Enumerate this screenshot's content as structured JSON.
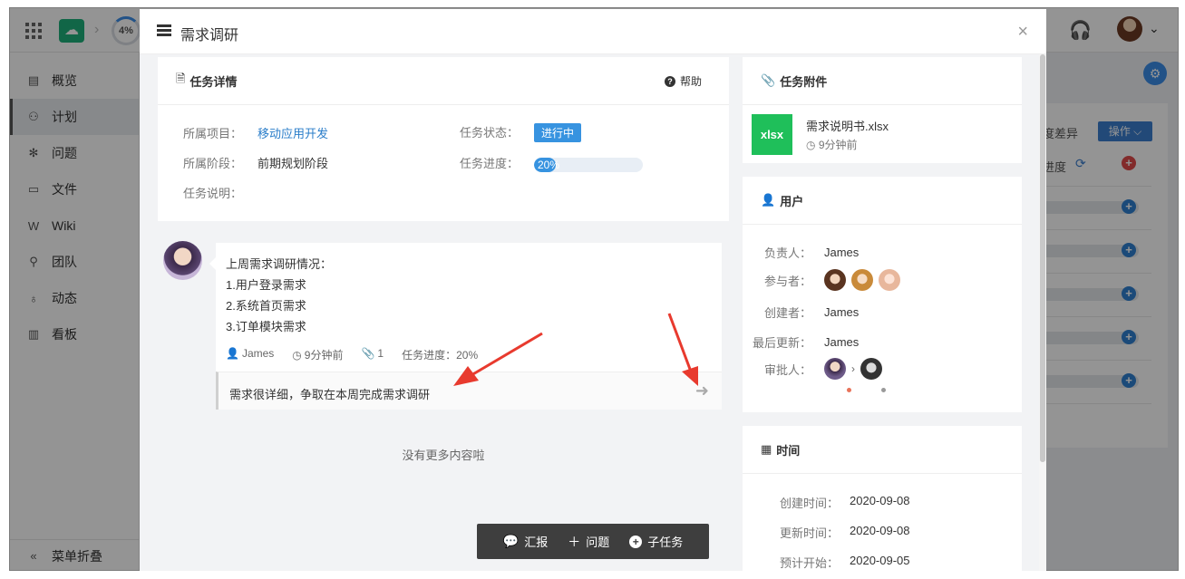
{
  "app": {
    "progress_ring": "4%",
    "sidebar": {
      "items": [
        {
          "label": "概览",
          "icon": "overview-icon",
          "glyph": "▤"
        },
        {
          "label": "计划",
          "icon": "plan-icon",
          "glyph": "⚇"
        },
        {
          "label": "问题",
          "icon": "bug-icon",
          "glyph": "✻"
        },
        {
          "label": "文件",
          "icon": "folder-icon",
          "glyph": "▭"
        },
        {
          "label": "Wiki",
          "icon": "wiki-icon",
          "glyph": "W"
        },
        {
          "label": "团队",
          "icon": "team-icon",
          "glyph": "⚲"
        },
        {
          "label": "动态",
          "icon": "activity-icon",
          "glyph": "♁"
        },
        {
          "label": "看板",
          "icon": "board-icon",
          "glyph": "▥"
        }
      ],
      "active_index": 1,
      "collapse_label": "菜单折叠"
    },
    "background": {
      "progress_diff_label": "度差异",
      "operate_button": "操作 ⌵",
      "progress_label": "进度"
    }
  },
  "modal": {
    "title": "需求调研",
    "close_glyph": "×",
    "task_detail": {
      "heading": "任务详情",
      "help_label": "帮助",
      "project_label": "所属项目：",
      "project_value": "移动应用开发",
      "stage_label": "所属阶段：",
      "stage_value": "前期规划阶段",
      "desc_label": "任务说明：",
      "status_label": "任务状态：",
      "status_value": "进行中",
      "progress_label": "任务进度：",
      "progress_text": "20%",
      "progress_fraction": 0.2
    },
    "comment": {
      "lines": [
        "上周需求调研情况：",
        "1.用户登录需求",
        "2.系统首页需求",
        "3.订单模块需求"
      ],
      "author": "James",
      "time": "9分钟前",
      "attachments": "1",
      "progress": "任务进度：20%",
      "reply": "需求很详细，争取在本周完成需求调研"
    },
    "no_more": "没有更多内容啦",
    "actions": {
      "report": "汇报",
      "issue": "问题",
      "subtask": "子任务"
    },
    "attachments": {
      "heading": "任务附件",
      "file_badge": "xlsx",
      "file_name": "需求说明书.xlsx",
      "file_time": "9分钟前"
    },
    "users": {
      "heading": "用户",
      "owner_label": "负责人：",
      "owner": "James",
      "participants_label": "参与者：",
      "creator_label": "创建者：",
      "creator": "James",
      "updated_by_label": "最后更新：",
      "updated_by": "James",
      "approver_label": "审批人：",
      "approver_dot_colors": [
        "#e8735a",
        "#999999"
      ]
    },
    "time": {
      "heading": "时间",
      "created_label": "创建时间：",
      "created": "2020-09-08",
      "updated_label": "更新时间：",
      "updated": "2020-09-08",
      "planned_start_label": "预计开始：",
      "planned_start": "2020-09-05"
    }
  },
  "colors": {
    "accent": "#3793e0",
    "badge_bg": "#3793e0",
    "xlsx": "#1fbf5a",
    "annotation_arrow": "#e83a2e"
  }
}
